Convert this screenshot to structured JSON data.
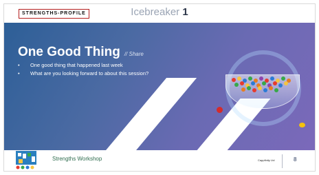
{
  "header": {
    "brand_label": "STRENGTHS-PROFILE",
    "section_title": "Icebreaker",
    "section_number": "1"
  },
  "content": {
    "title": "One Good Thing",
    "share_label": "// Share",
    "bullets": [
      "One good thing that happened last week",
      "What are you looking forward to about this session?"
    ]
  },
  "footer": {
    "workshop_label": "Strengths Workshop",
    "company_label": "Cappfinity Ltd",
    "page_number": "8"
  },
  "colors": {
    "gradient_start": "#2d5f97",
    "gradient_end": "#7b69ba",
    "brand_border": "#b41e1e",
    "footer_text": "#2f6d4f"
  },
  "icons": [
    "strengths-logo-icon",
    "candy-bowl-image",
    "ring-decoration"
  ]
}
